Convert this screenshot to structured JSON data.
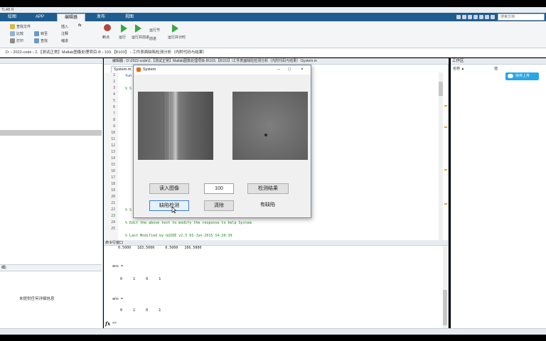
{
  "window": {
    "title": "TLAB R"
  },
  "ribbon_tabs": [
    "绘图",
    "APP",
    "编辑器",
    "发布",
    "视图"
  ],
  "search_placeholder": "搜索文档",
  "ribbon": {
    "find_files": "查找文件",
    "compare": "比较",
    "print": "打印",
    "goto": "转至",
    "find": "查找",
    "insert": "插入",
    "comment": "注释",
    "indent": "缩进",
    "breakpoints": "断点",
    "run": "运行",
    "run_advance": "运行并前进",
    "run_section": "运行节",
    "advance": "前进",
    "run_time": "运行并计时"
  },
  "address_path": "D: › 2022-code › 2.【测试正常】Matlab图像处理项目-B › 103.【B103】 › 工件表面缺陷检测分析（内附代码与结果）",
  "editor": {
    "title": "编辑器 - D:\\2022-code\\2.【测试正常】Matlab图像处理项目-B\\103.【B103】\\工件表面缺陷检测分析（内附代码与结果）\\System.m",
    "tab": "System.m",
    "line_numbers": [
      "1",
      "2",
      "3",
      "4",
      "5",
      "6",
      "7",
      "8",
      "9",
      "10",
      "11",
      "12",
      "13",
      "14",
      "15",
      "16",
      "17",
      "18",
      "19",
      "20",
      "21",
      "22",
      "23",
      "24",
      "25"
    ],
    "line1_code": "fun",
    "line3_code": "% S",
    "line22_code": "% S",
    "line24_code": "% Edit the above text to modify the response to help System",
    "line26_code": "% Last Modified by GUIDE v2.5 03-Jun-2015 14:20:39"
  },
  "command_window": {
    "title": "命令行窗口",
    "lines": [
      "    0.5000   183.5000     0.5000   166.5000",
      "ans =",
      "     0     1     0     1",
      "ans =",
      "     0     1     0     1"
    ],
    "prompt": ">>"
  },
  "left_panel": {
    "section_label": "细)",
    "note": "未提供任何详细信息"
  },
  "workspace": {
    "title": "工作区",
    "col_name": "名称 ▲",
    "col_value": "值",
    "upload": "快传上传"
  },
  "dialog": {
    "title": "System",
    "btn_read": "读入图像",
    "value": "100",
    "btn_result": "检测结果",
    "btn_defect": "缺陷检测",
    "btn_clear": "清除",
    "result_text": "有缺陷"
  }
}
